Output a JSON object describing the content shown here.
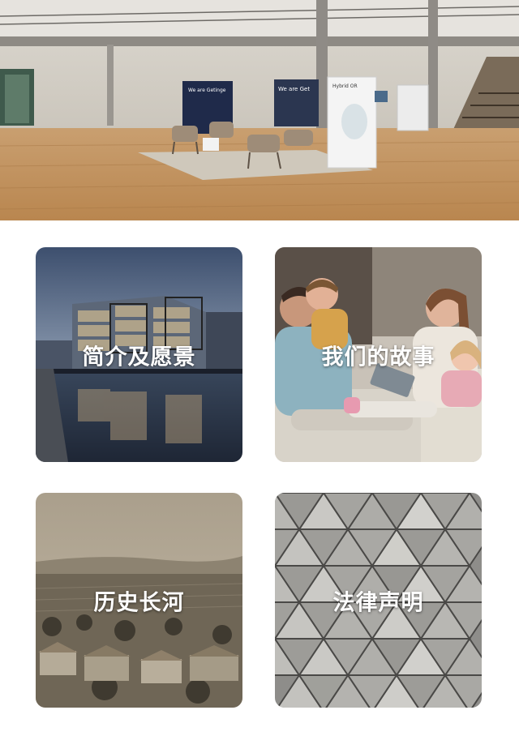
{
  "hero": {
    "image": "lobby-photo",
    "booth_sign_left": "We are Getinge",
    "booth_sign_mid": "We are Get",
    "booth_sign_right": "Hybrid OR"
  },
  "cards": [
    {
      "label": "简介及愿景",
      "image": "glass-office-building-photo"
    },
    {
      "label": "我们的故事",
      "image": "family-on-sofa-photo"
    },
    {
      "label": "历史长河",
      "image": "sepia-town-landscape-photo"
    },
    {
      "label": "法律声明",
      "image": "triangle-facade-photo"
    }
  ],
  "colors": {
    "background": "#ffffff",
    "label_text": "#ffffff"
  }
}
